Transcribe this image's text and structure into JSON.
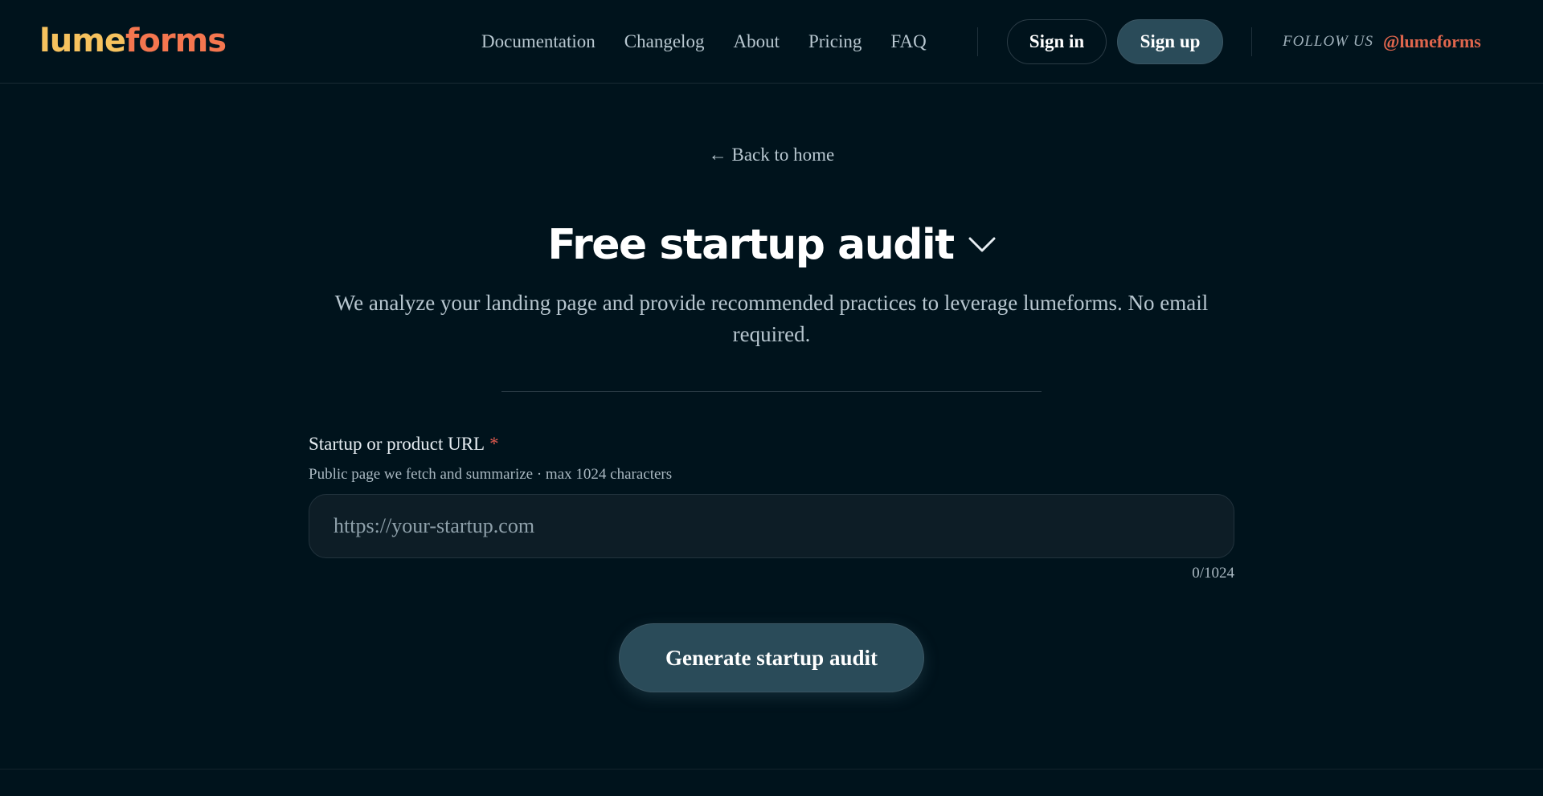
{
  "header": {
    "logo": {
      "part_a": "lume",
      "part_b": "forms"
    },
    "nav": [
      "Documentation",
      "Changelog",
      "About",
      "Pricing",
      "FAQ"
    ],
    "sign_in_label": "Sign in",
    "sign_up_label": "Sign up",
    "follow_label": "FOLLOW US",
    "follow_handle": "@lumeforms"
  },
  "main": {
    "back_link": "← Back to home",
    "title": "Free startup audit",
    "title_icon": "chevron-down-icon",
    "subtitle": "We analyze your landing page and provide recommended practices to leverage lumeforms. No email required.",
    "form": {
      "url_label": "Startup or product URL",
      "required_marker": "*",
      "url_help": "Public page we fetch and summarize · max 1024 characters",
      "url_placeholder": "https://your-startup.com",
      "url_value": "",
      "counter": "0/1024",
      "submit_label": "Generate startup audit"
    }
  },
  "colors": {
    "background": "#00131c",
    "accent_button": "#2a4b59",
    "logo_yellow": "#f6c25e",
    "logo_orange": "#f4764f",
    "handle": "#e0664d",
    "required": "#e05a4f"
  }
}
